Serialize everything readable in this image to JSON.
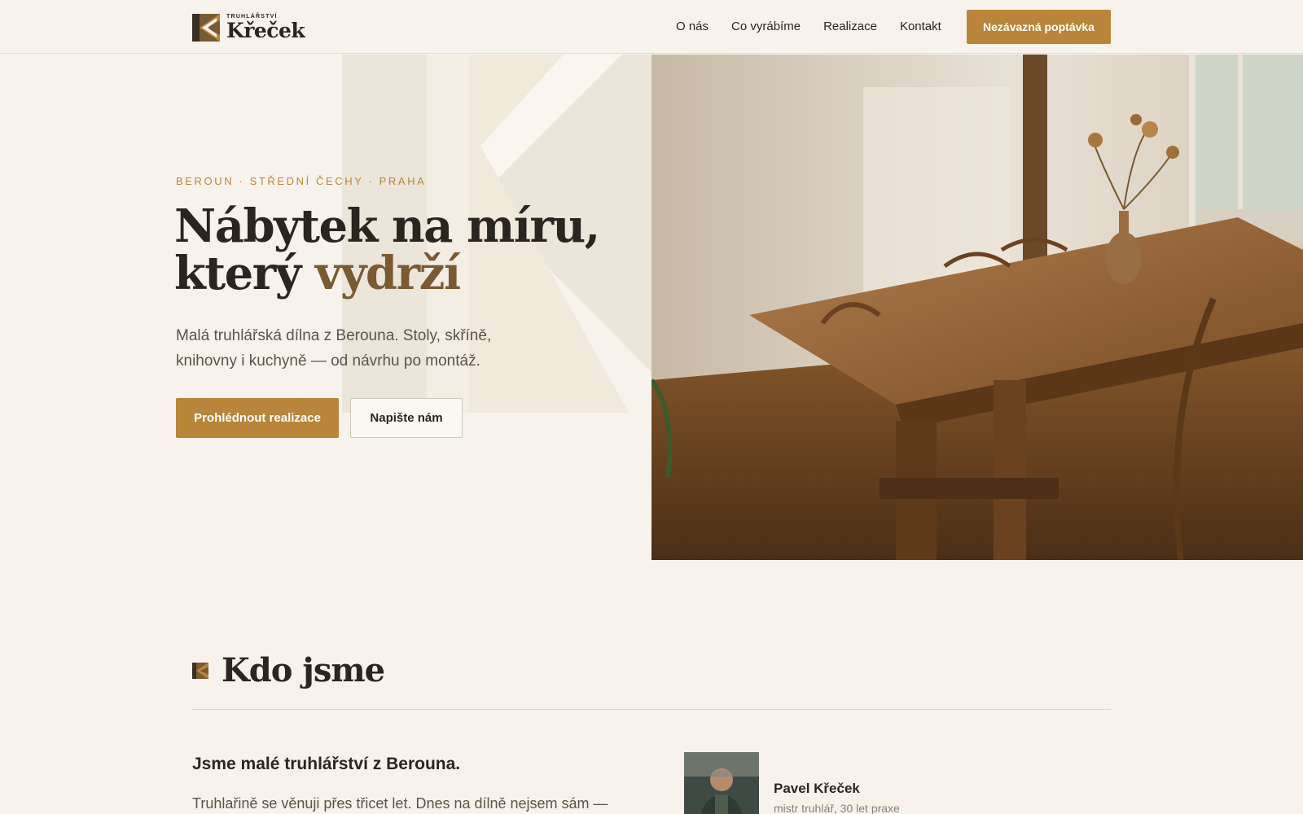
{
  "header": {
    "logo_small": "TRUHLÁŘSTVÍ",
    "logo_big": "Křeček",
    "nav": [
      "O nás",
      "Co vyrábíme",
      "Realizace",
      "Kontakt"
    ],
    "cta": "Nezávazná poptávka"
  },
  "hero": {
    "eyebrow": "BEROUN · STŘEDNÍ ČECHY · PRAHA",
    "title_line1": "Nábytek na míru,",
    "title_line2_plain": "který ",
    "title_line2_accent": "vydrží",
    "lead": "Malá truhlářská dílna z Berouna. Stoly, skříně, knihovny i kuchyně — od návrhu po montáž.",
    "btn_primary": "Prohlédnout realizace",
    "btn_secondary": "Napište nám"
  },
  "about": {
    "title": "Kdo jsme",
    "heading": "Jsme malé truhlářství z Berouna.",
    "text": "Truhlařině se věnuji přes třicet let. Dnes na dílně nejsem sám —",
    "person_name": "Pavel Křeček",
    "person_role": "mistr truhlář, 30 let praxe"
  },
  "colors": {
    "accent": "#b8853a",
    "accent_dark": "#7a5a32",
    "background": "#f7f3ec",
    "text": "#2b2520"
  }
}
